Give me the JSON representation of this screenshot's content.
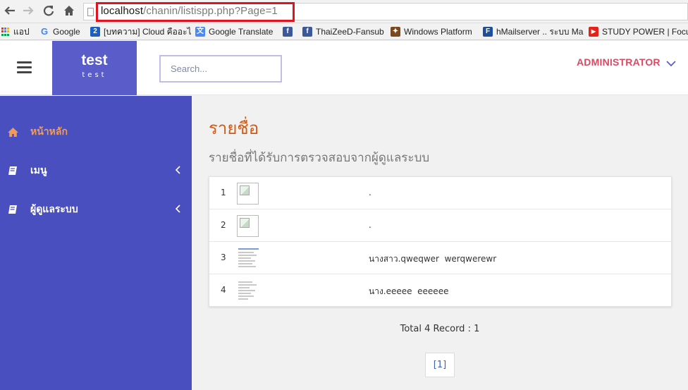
{
  "browser": {
    "url_host": "localhost",
    "url_path": "/chanin/listispp.php?Page=1",
    "bookmarks": [
      {
        "label": "แอป",
        "icon": "apps-grid-icon"
      },
      {
        "label": "Google",
        "icon": "google-icon"
      },
      {
        "label": "[บทความ] Cloud คืออะไ",
        "icon": "bookmark-2-icon"
      },
      {
        "label": "Google Translate",
        "icon": "google-translate-icon"
      },
      {
        "label": "",
        "icon": "facebook-icon"
      },
      {
        "label": "ThaiZeeD-Fansub",
        "icon": "facebook-icon"
      },
      {
        "label": "Windows Platform",
        "icon": "windows-platform-icon"
      },
      {
        "label": "hMailserver .. ระบบ Ma",
        "icon": "facebook-icon"
      },
      {
        "label": "STUDY POWER | Focu",
        "icon": "youtube-icon"
      }
    ]
  },
  "header": {
    "brand_title": "test",
    "brand_subtitle": "test",
    "search_placeholder": "Search...",
    "user_label": "ADMINISTRATOR"
  },
  "sidebar": {
    "items": [
      {
        "label": "หน้าหลัก",
        "icon": "home-icon",
        "active": true
      },
      {
        "label": "เมนู",
        "icon": "book-icon",
        "has_submenu": true
      },
      {
        "label": "ผู้ดูแลระบบ",
        "icon": "book-icon",
        "has_submenu": true
      }
    ]
  },
  "main": {
    "title": "รายชื่อ",
    "subtitle": "รายชื่อที่ได้รับการตรวจสอบจากผู้ดูแลระบบ",
    "rows": [
      {
        "num": "1",
        "image": "broken-image",
        "name": "."
      },
      {
        "num": "2",
        "image": "broken-image",
        "name": "."
      },
      {
        "num": "3",
        "image": "document-thumbnail",
        "name": "นางสาว.qweqwer  werqwerewr"
      },
      {
        "num": "4",
        "image": "document-thumbnail",
        "name": "นาง.eeeee  eeeeee"
      }
    ],
    "total_text": "Total 4 Record : 1",
    "pager_label": "[1]"
  },
  "colors": {
    "sidebar_bg": "#4a4fc0",
    "brand_bg": "#5a5cc9",
    "active_nav": "#f39a55",
    "title_color": "#d35a14",
    "admin_color": "#d94a62",
    "url_highlight": "#e0141e"
  }
}
